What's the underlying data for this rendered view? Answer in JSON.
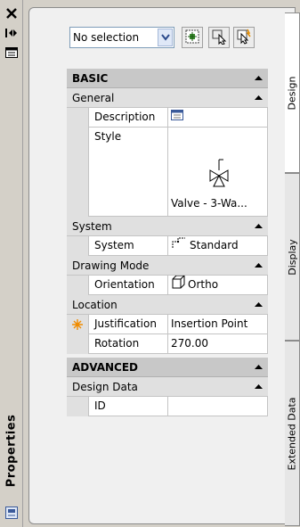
{
  "palette": {
    "title": "Properties",
    "tabs": [
      {
        "label": "Design",
        "active": true
      },
      {
        "label": "Display",
        "active": false
      },
      {
        "label": "Extended Data",
        "active": false
      }
    ]
  },
  "toolbar": {
    "selection_value": "No selection",
    "buttons": [
      "quick-select-icon",
      "select-objects-icon",
      "toggle-pickadd-icon"
    ]
  },
  "grid": {
    "basic": {
      "label": "BASIC",
      "general": {
        "label": "General",
        "description": {
          "name": "Description",
          "icon": "description-dialog-icon"
        },
        "style": {
          "name": "Style",
          "value": "Valve - 3-Wa...",
          "icon": "three-way-valve-icon"
        }
      },
      "system": {
        "label": "System",
        "system": {
          "name": "System",
          "value": "Standard",
          "icon": "system-icon"
        }
      },
      "drawing_mode": {
        "label": "Drawing Mode",
        "orientation": {
          "name": "Orientation",
          "value": "Ortho",
          "icon": "ortho-cube-icon"
        }
      },
      "location": {
        "label": "Location",
        "justification": {
          "name": "Justification",
          "value": "Insertion Point",
          "icon": "pick-point-icon"
        },
        "rotation": {
          "name": "Rotation",
          "value": "270.00"
        }
      }
    },
    "advanced": {
      "label": "ADVANCED",
      "design_data": {
        "label": "Design Data",
        "id": {
          "name": "ID",
          "value": ""
        }
      }
    }
  },
  "colors": {
    "category_bg": "#c8c8c8",
    "subcategory_bg": "#e0e0e0",
    "panel_bg": "#d4d0c8",
    "accent_orange": "#f08c00"
  }
}
